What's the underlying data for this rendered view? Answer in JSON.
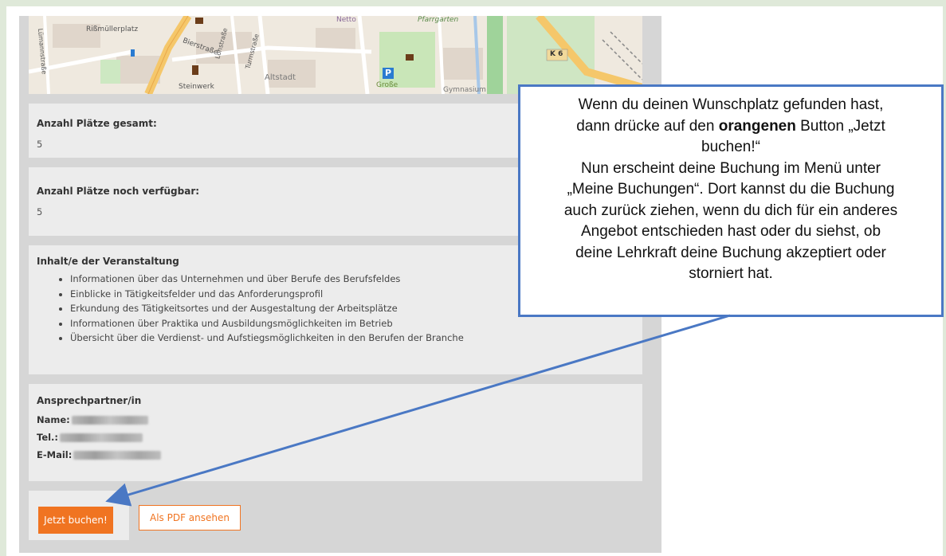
{
  "map": {
    "labels": {
      "rissmuellerplatz": "Rißmüllerplatz",
      "netto": "Netto",
      "pfarrgarten": "Pfarrgarten",
      "bierstrasse": "Bierstraße",
      "altstadt": "Altstadt",
      "steinwerk": "Steinwerk",
      "grosse": "Große",
      "gymnasium": "Gymnasium",
      "lohstrasse": "Lohstraße",
      "turmstrasse": "Turmstraße",
      "lumannstrasse": "Lümannstraße",
      "k6": "K 6",
      "parking": "P"
    }
  },
  "fields": {
    "total_label": "Anzahl Plätze gesamt:",
    "total_value": "5",
    "available_label": "Anzahl Plätze noch verfügbar:",
    "available_value": "5",
    "content_label": "Inhalt/e der Veranstaltung",
    "content_items": [
      "Informationen über das Unternehmen und über Berufe des Berufsfeldes",
      "Einblicke in Tätigkeitsfelder und das Anforderungsprofil",
      "Erkundung des Tätigkeitsortes und der Ausgestaltung der Arbeitsplätze",
      "Informationen über Praktika und Ausbildungsmöglichkeiten im Betrieb",
      "Übersicht über die Verdienst- und Aufstiegsmöglichkeiten in den Berufen der Branche"
    ]
  },
  "contact": {
    "heading": "Ansprechpartner/in",
    "name_label": "Name:",
    "phone_label": "Tel.:",
    "email_label": "E-Mail:"
  },
  "buttons": {
    "book_label": "Jetzt buchen!",
    "pdf_label": "Als PDF ansehen"
  },
  "callout": {
    "line1": "Wenn du deinen Wunschplatz gefunden hast,",
    "line2_pre": "dann drücke auf den ",
    "line2_bold": "orangenen",
    "line2_post": " Button „Jetzt",
    "line3": "buchen!“",
    "line4": "Nun erscheint deine Buchung im Menü unter",
    "line5": "„Meine Buchungen“. Dort kannst du die Buchung",
    "line6": "auch zurück ziehen, wenn du dich für ein anderes",
    "line7": "Angebot entschieden hast oder du siehst, ob",
    "line8": "deine Lehrkraft deine Buchung akzeptiert oder",
    "line9": "storniert hat."
  },
  "colors": {
    "accent_orange": "#f07421",
    "callout_border": "#4a78c4",
    "panel_gray": "#d6d6d6",
    "card_gray": "#ececec"
  }
}
